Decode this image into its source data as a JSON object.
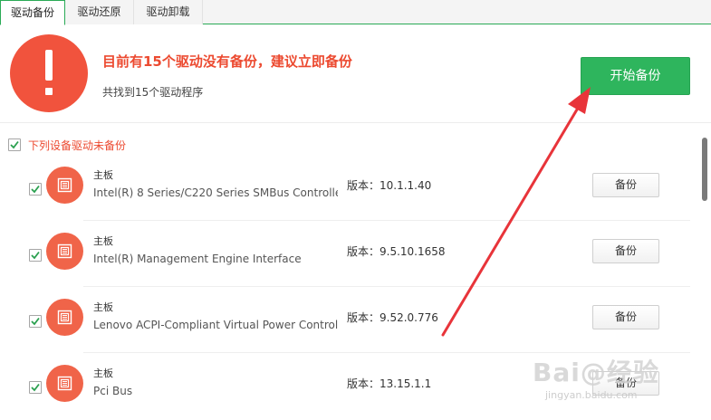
{
  "tabs": [
    {
      "label": "驱动备份",
      "active": true
    },
    {
      "label": "驱动还原",
      "active": false
    },
    {
      "label": "驱动卸载",
      "active": false
    }
  ],
  "header": {
    "title": "目前有15个驱动没有备份，建议立即备份",
    "subtitle": "共找到15个驱动程序",
    "start_button": "开始备份",
    "warning_icon": "exclamation-icon"
  },
  "section": {
    "label": "下列设备驱动未备份",
    "checked": true
  },
  "devices": [
    {
      "category": "主板",
      "name": "Intel(R) 8 Series/C220 Series SMBus Controlle",
      "version": "版本：10.1.1.40",
      "button": "备份",
      "checked": true
    },
    {
      "category": "主板",
      "name": "Intel(R) Management Engine Interface",
      "version": "版本：9.5.10.1658",
      "button": "备份",
      "checked": true
    },
    {
      "category": "主板",
      "name": "Lenovo ACPI-Compliant Virtual Power Controll",
      "version": "版本：9.52.0.776",
      "button": "备份",
      "checked": true
    },
    {
      "category": "主板",
      "name": "Pci Bus",
      "version": "版本：13.15.1.1",
      "button": "备份",
      "checked": true
    }
  ],
  "watermark": {
    "main": "Bai@经验",
    "sub": "jingyan.baidu.com"
  },
  "colors": {
    "accent_green": "#2eb55d",
    "warning_red": "#f1533d",
    "device_icon": "#f06449",
    "arrow_red": "#e8343a"
  }
}
